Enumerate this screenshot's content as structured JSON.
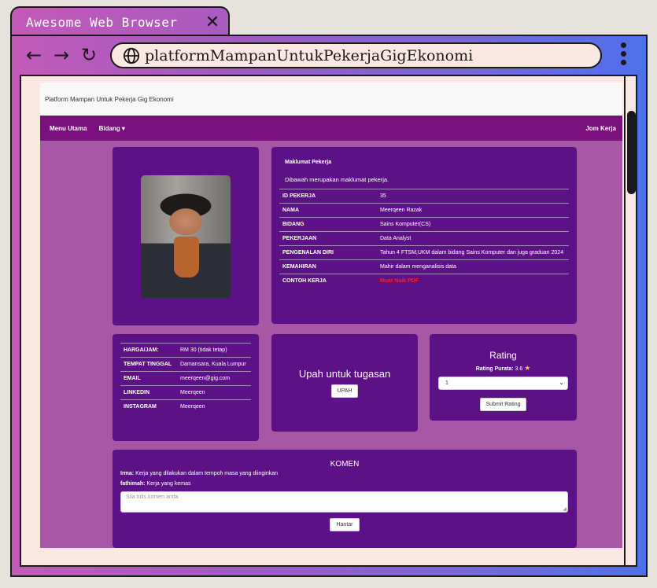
{
  "browser": {
    "tab_title": "Awesome Web Browser",
    "url": "platformMampanUntukPekerjaGigEkonomi"
  },
  "site": {
    "header_title": "Platform Mampan Untuk Pekerja Gig Ekonomi",
    "nav": {
      "menu_utama": "Menu Utama",
      "bidang": "Bidang ▾",
      "jom_kerja": "Jom Kerja"
    }
  },
  "profile": {
    "title": "Maklumat Pekerja",
    "description": "Dibawah merupakan maklumat pekerja.",
    "rows": [
      {
        "k": "ID PEKERJA",
        "v": "35"
      },
      {
        "k": "NAMA",
        "v": "Meerqeen Razak"
      },
      {
        "k": "BIDANG",
        "v": "Sains Komputer(CS)"
      },
      {
        "k": "PEKERJAAN",
        "v": "Data Analyst"
      },
      {
        "k": "PENGENALAN DIRI",
        "v": "Tahun 4 FTSM,UKM dalam bidang Sains Komputer dan juga graduan 2024"
      },
      {
        "k": "KEMAHIRAN",
        "v": "Mahir dalam menganalisis data"
      },
      {
        "k": "CONTOH KERJA",
        "v": "Muat Naik PDF"
      }
    ]
  },
  "contact": {
    "rows": [
      {
        "k": "HARGA/JAM:",
        "v": "RM 30 (tidak tetap)"
      },
      {
        "k": "TEMPAT TINGGAL",
        "v": "Damansara, Kuala Lumpur"
      },
      {
        "k": "EMAIL",
        "v": "meerqeen@gig.com"
      },
      {
        "k": "LINKEDIN",
        "v": "Meerqeen"
      },
      {
        "k": "INSTAGRAM",
        "v": "Meerqeen"
      }
    ]
  },
  "upah": {
    "title": "Upah untuk tugasan",
    "button": "UPAH"
  },
  "rating": {
    "title": "Rating",
    "avg_label": "Rating Purata:",
    "avg_value": "3.6",
    "selected": "1",
    "submit": "Submit Rating",
    "star_color": "#f5c518"
  },
  "komen": {
    "title": "KOMEN",
    "comments": [
      {
        "author": "Irma:",
        "text": "Kerja yang dilakukan dalam tempoh masa yang diinginkan"
      },
      {
        "author": "fathimah:",
        "text": "Kerja yang kemas"
      }
    ],
    "placeholder": "Sila tulis komen anda",
    "submit": "Hantar"
  },
  "colors": {
    "navbar": "#7a0f7e",
    "card": "#5c1187",
    "page_bg": "#a857a6",
    "link_red": "#ff1e1e"
  }
}
